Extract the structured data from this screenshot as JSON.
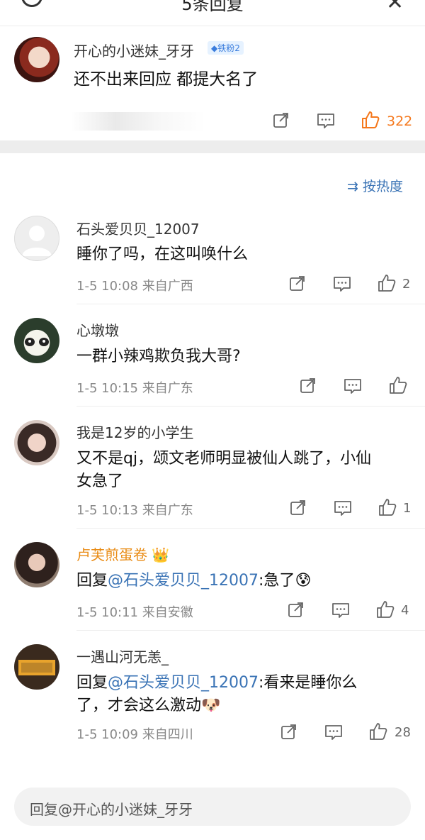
{
  "header": {
    "title": "5条回复"
  },
  "main_comment": {
    "username": "开心的小迷妹_牙牙",
    "badge": "铁粉2",
    "text": "还不出来回应 都提大名了",
    "likes": "322"
  },
  "sort_label": "按热度",
  "replies": [
    {
      "username": "石头爱贝贝_12007",
      "text": "睡你了吗，在这叫唤什么",
      "time": "1-5 10:08",
      "location": "来自广西",
      "likes": "2"
    },
    {
      "username": "心墩墩",
      "text": "一群小辣鸡欺负我大哥?",
      "time": "1-5 10:15",
      "location": "来自广东",
      "likes": ""
    },
    {
      "username": "我是12岁的小学生",
      "text_line1": "又不是qj，颂文老师明显被仙人跳了，小仙",
      "text_line2": "女急了",
      "time": "1-5 10:13",
      "location": "来自广东",
      "likes": "1"
    },
    {
      "username": "卢芙煎蛋卷",
      "reply_prefix": "回复",
      "mention": "@石头爱贝贝_12007",
      "text": ":急了",
      "time": "1-5 10:11",
      "location": "来自安徽",
      "likes": "4"
    },
    {
      "username": "一遇山河无恙_",
      "reply_prefix": "回复",
      "mention": "@石头爱贝贝_12007",
      "text_line1": ":看来是睡你么",
      "text_line2": "了，才会这么激动",
      "time": "1-5 10:09",
      "location": "来自四川",
      "likes": "28"
    }
  ],
  "reply_input": {
    "placeholder": "回复@开心的小迷妹_牙牙"
  },
  "icons": {
    "share": "share-icon",
    "comment": "comment-icon",
    "like": "thumbs-up-icon",
    "close": "close-icon",
    "refresh": "refresh-icon",
    "sort": "sort-icon",
    "crown": "crown-icon"
  },
  "colors": {
    "accent": "#3a73b5",
    "like_active": "#f5781c",
    "vip_name": "#e98b14"
  }
}
